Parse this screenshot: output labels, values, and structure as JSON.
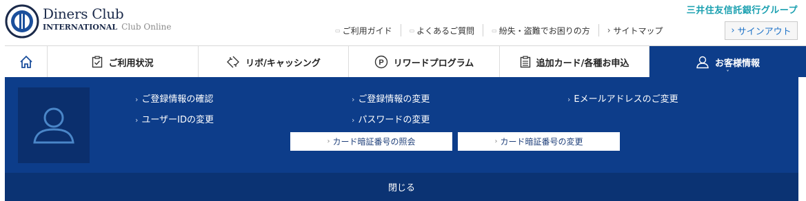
{
  "header": {
    "brand_line1": "Diners Club",
    "brand_line2": "INTERNATIONAL",
    "brand_suffix": "Club Online",
    "bank_group": "三井住友信託銀行グループ",
    "utility_links": [
      {
        "label": "ご利用ガイド"
      },
      {
        "label": "よくあるご質問"
      },
      {
        "label": "紛失・盗難でお困りの方"
      },
      {
        "label": "サイトマップ"
      }
    ],
    "signout_label": "サインアウト"
  },
  "nav": {
    "items": [
      {
        "label": "ご利用状況",
        "icon": "clipboard-check-icon"
      },
      {
        "label": "リボ/キャッシング",
        "icon": "cycle-arrows-icon"
      },
      {
        "label": "リワードプログラム",
        "icon": "p-circle-icon"
      },
      {
        "label": "追加カード/各種お申込",
        "icon": "document-list-icon"
      },
      {
        "label": "お客様情報",
        "icon": "user-icon",
        "active": true
      }
    ]
  },
  "panel": {
    "links_row1": [
      {
        "label": "ご登録情報の確認"
      },
      {
        "label": "ご登録情報の変更"
      },
      {
        "label": "Eメールアドレスのご変更"
      }
    ],
    "links_row2": [
      {
        "label": "ユーザーIDの変更"
      },
      {
        "label": "パスワードの変更"
      }
    ],
    "pin_buttons": [
      {
        "label": "カード暗証番号の照会"
      },
      {
        "label": "カード暗証番号の変更"
      }
    ],
    "close_label": "閉じる"
  },
  "colors": {
    "nav_active": "#0d3d8a",
    "panel_bg": "#0d3d8a",
    "close_bar": "#0b3373",
    "bank_text": "#1aa0b0",
    "link_blue": "#1e73c8"
  }
}
